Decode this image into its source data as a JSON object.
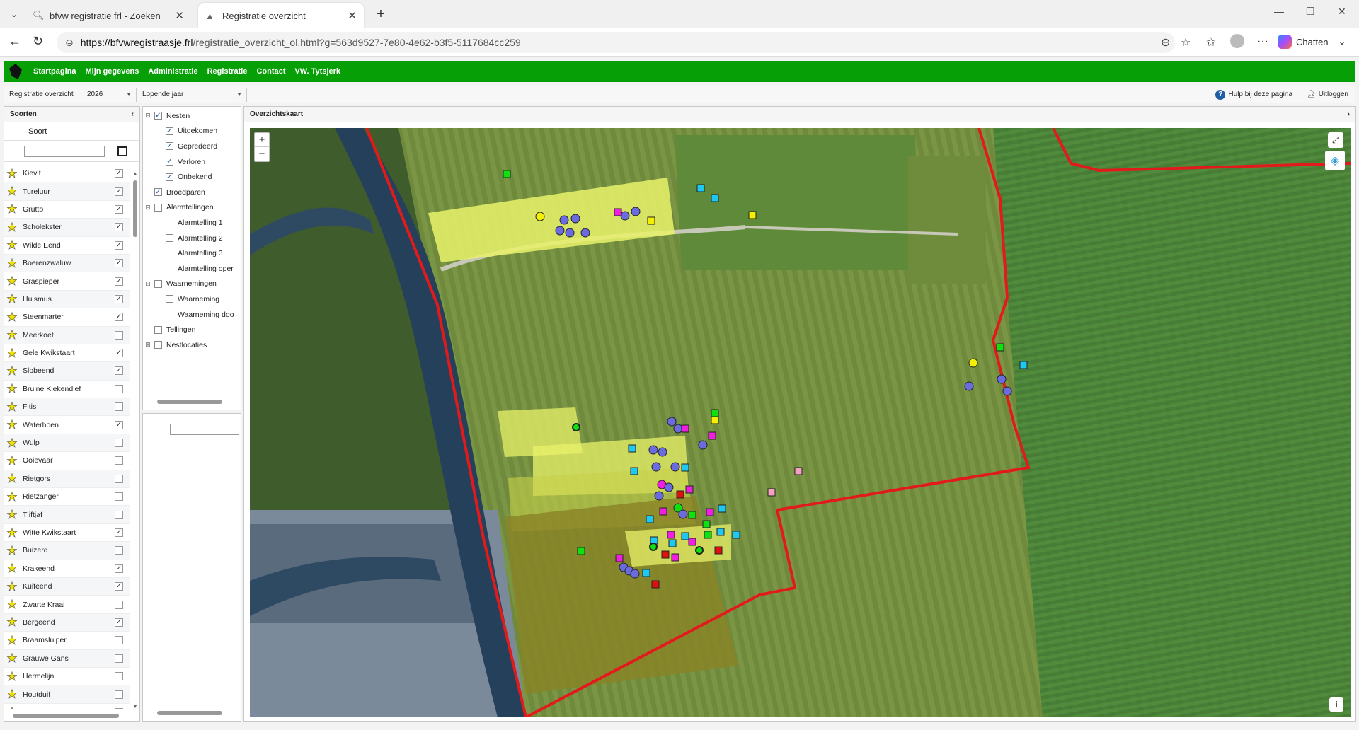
{
  "browser": {
    "tabs": [
      {
        "title": "bfvw registratie frl - Zoeken",
        "active": false
      },
      {
        "title": "Registratie overzicht",
        "active": true
      }
    ],
    "url_host": "https://bfvwregistraasje.frl",
    "url_path": "/registratie_overzicht_ol.html?g=563d9527-7e80-4e62-b3f5-5117684cc259",
    "chat_label": "Chatten"
  },
  "menu": [
    "Startpagina",
    "Mijn gegevens",
    "Administratie",
    "Registratie",
    "Contact",
    "VW. Tytsjerk"
  ],
  "toolbar": {
    "view": "Registratie overzicht",
    "year": "2026",
    "period": "Lopende jaar",
    "help": "Hulp bij deze pagina",
    "logout": "Uitloggen"
  },
  "soorten": {
    "title": "Soorten",
    "column": "Soort",
    "items": [
      {
        "name": "Kievit",
        "checked": true
      },
      {
        "name": "Tureluur",
        "checked": true
      },
      {
        "name": "Grutto",
        "checked": true
      },
      {
        "name": "Scholekster",
        "checked": true
      },
      {
        "name": "Wilde Eend",
        "checked": true
      },
      {
        "name": "Boerenzwaluw",
        "checked": true
      },
      {
        "name": "Graspieper",
        "checked": true
      },
      {
        "name": "Huismus",
        "checked": true
      },
      {
        "name": "Steenmarter",
        "checked": true
      },
      {
        "name": "Meerkoet",
        "checked": false
      },
      {
        "name": "Gele Kwikstaart",
        "checked": true
      },
      {
        "name": "Slobeend",
        "checked": true
      },
      {
        "name": "Bruine Kiekendief",
        "checked": false
      },
      {
        "name": "Fitis",
        "checked": false
      },
      {
        "name": "Waterhoen",
        "checked": true
      },
      {
        "name": "Wulp",
        "checked": false
      },
      {
        "name": "Ooievaar",
        "checked": false
      },
      {
        "name": "Rietgors",
        "checked": false
      },
      {
        "name": "Rietzanger",
        "checked": false
      },
      {
        "name": "Tjiftjaf",
        "checked": false
      },
      {
        "name": "Witte Kwikstaart",
        "checked": true
      },
      {
        "name": "Buizerd",
        "checked": false
      },
      {
        "name": "Krakeend",
        "checked": true
      },
      {
        "name": "Kuifeend",
        "checked": true
      },
      {
        "name": "Zwarte Kraai",
        "checked": false
      },
      {
        "name": "Bergeend",
        "checked": true
      },
      {
        "name": "Braamsluiper",
        "checked": false
      },
      {
        "name": "Grauwe Gans",
        "checked": false
      },
      {
        "name": "Hermelijn",
        "checked": false
      },
      {
        "name": "Houtduif",
        "checked": false
      },
      {
        "name": "Huiszwaluw",
        "checked": false
      }
    ]
  },
  "layers": [
    {
      "label": "Nesten",
      "level": 0,
      "checked": true,
      "expander": "minus"
    },
    {
      "label": "Uitgekomen",
      "level": 1,
      "checked": true
    },
    {
      "label": "Gepredeerd",
      "level": 1,
      "checked": true
    },
    {
      "label": "Verloren",
      "level": 1,
      "checked": true
    },
    {
      "label": "Onbekend",
      "level": 1,
      "checked": true
    },
    {
      "label": "Broedparen",
      "level": 0,
      "checked": true
    },
    {
      "label": "Alarmtellingen",
      "level": 0,
      "checked": false,
      "expander": "minus"
    },
    {
      "label": "Alarmtelling 1",
      "level": 1,
      "checked": false
    },
    {
      "label": "Alarmtelling 2",
      "level": 1,
      "checked": false
    },
    {
      "label": "Alarmtelling 3",
      "level": 1,
      "checked": false
    },
    {
      "label": "Alarmtelling oper",
      "level": 1,
      "checked": false
    },
    {
      "label": "Waarnemingen",
      "level": 0,
      "checked": false,
      "expander": "minus"
    },
    {
      "label": "Waarneming",
      "level": 1,
      "checked": false
    },
    {
      "label": "Waarneming doo",
      "level": 1,
      "checked": false
    },
    {
      "label": "Tellingen",
      "level": 0,
      "checked": false
    },
    {
      "label": "Nestlocaties",
      "level": 0,
      "checked": false,
      "expander": "plus"
    }
  ],
  "map": {
    "title": "Overzichtskaart",
    "zoom_in": "+",
    "zoom_out": "−",
    "info_label": "i",
    "icons": [
      "fullscreen-icon",
      "layers-icon",
      "info-icon"
    ],
    "colors": {
      "boundary": "#e31a1c",
      "field": "#e9f26a",
      "circle": "#6b6be0",
      "square_cyan": "#1ec8f0",
      "square_magenta": "#f01ee0",
      "square_green": "#10e010",
      "square_yellow": "#f4f000",
      "square_red": "#e01010",
      "square_pink": "#f4a0c0"
    }
  }
}
